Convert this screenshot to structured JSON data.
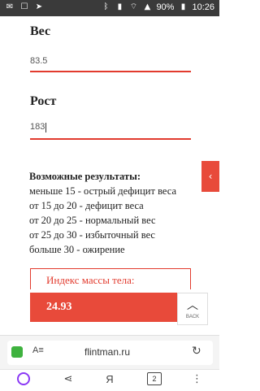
{
  "statusbar": {
    "battery": "90%",
    "time": "10:26"
  },
  "form": {
    "weight_label": "Вес",
    "weight_value": "83.5",
    "height_label": "Рост",
    "height_value": "183"
  },
  "results": {
    "title": "Возможные результаты:",
    "lines": [
      "меньше 15 - острый дефицит веса",
      "от 15 до 20 - дефицит веса",
      "от 20 до 25 - нормальный вес",
      "от 25 до 30 - избыточный вес",
      "больше 30 - ожирение"
    ]
  },
  "bmi": {
    "label": "Индекс массы тела:",
    "value": "24.93"
  },
  "up_button": {
    "label": "BACK"
  },
  "browser": {
    "reader_label": "A≡",
    "url": "flintman.ru",
    "tabs_count": "2",
    "yandex_label": "Я"
  },
  "colors": {
    "accent": "#e84a3a",
    "lock": "#3fb23f",
    "assistant": "#8a38f5"
  }
}
